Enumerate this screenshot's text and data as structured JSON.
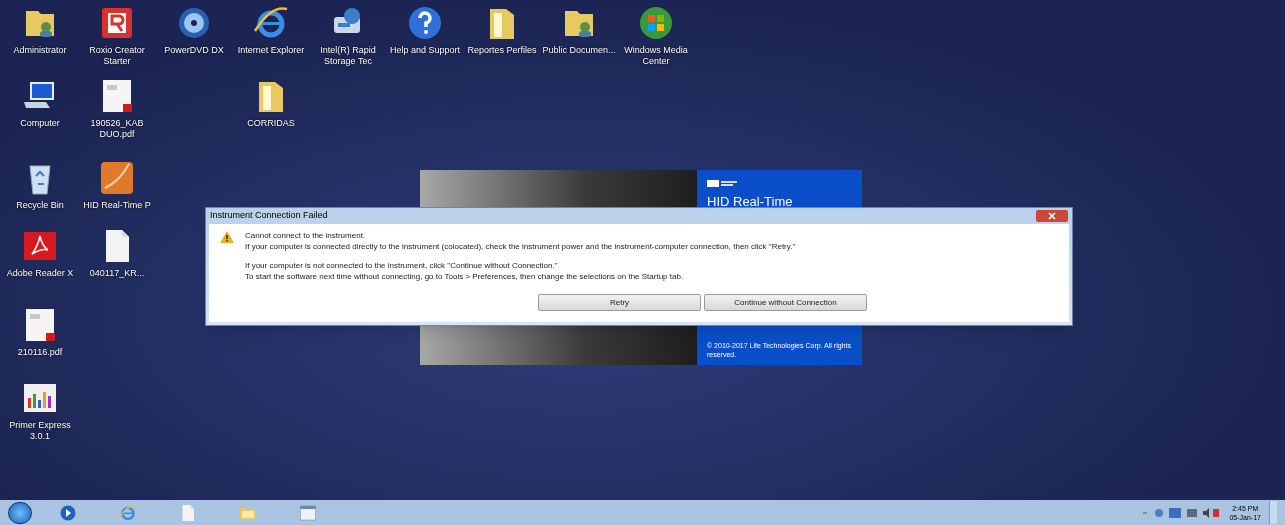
{
  "desktop_icons": [
    {
      "kind": "user-folder",
      "label": "Administrator"
    },
    {
      "kind": "app-r",
      "label": "Roxio Creator Starter"
    },
    {
      "kind": "disc",
      "label": "PowerDVD DX"
    },
    {
      "kind": "browser",
      "label": "Internet Explorer"
    },
    {
      "kind": "storage",
      "label": "Intel(R) Rapid Storage Tec"
    },
    {
      "kind": "help",
      "label": "Help and Support"
    },
    {
      "kind": "folder",
      "label": "Reportes Perfiles"
    },
    {
      "kind": "user-folder",
      "label": "Public Documen..."
    },
    {
      "kind": "media",
      "label": "Windows Media Center"
    },
    {
      "kind": "computer",
      "label": "Computer"
    },
    {
      "kind": "pdf",
      "label": "190526_KAB DUO.pdf"
    },
    {
      "kind": "folder",
      "label": "CORRIDAS"
    },
    {
      "kind": "recycle",
      "label": "Recycle Bin"
    },
    {
      "kind": "orange-app",
      "label": "HID Real-Time P"
    },
    {
      "kind": "reader",
      "label": "Adobe Reader X"
    },
    {
      "kind": "file",
      "label": "040117_KR..."
    },
    {
      "kind": "pdf",
      "label": "210116.pdf"
    },
    {
      "kind": "chart-app",
      "label": "Primer Express 3.0.1"
    }
  ],
  "splash": {
    "title": "HID Real-Time",
    "copyright": "© 2010-2017 Life Technologies Corp. All rights reserved."
  },
  "dialog": {
    "title": "Instrument Connection Failed",
    "heading": "Cannot connect to the instrument.",
    "lines": [
      "If your computer is connected directly to the instrument (colocated), check the instrument power and the instrument-computer connection, then click \"Retry.\"",
      "If your computer is not connected to the instrument, click \"Continue without Connection.\"",
      "To start the software next time without connecting, go to Tools > Preferences, then change the selections on the Startup tab."
    ],
    "buttons": [
      "Retry",
      "Continue without Connection"
    ]
  },
  "taskbar": {
    "pinned": [
      {
        "kind": "media-player"
      },
      {
        "kind": "browser"
      },
      {
        "kind": "file"
      },
      {
        "kind": "explorer"
      },
      {
        "kind": "app-window"
      }
    ],
    "time": "2:45 PM",
    "date": "05-Jan-17"
  }
}
